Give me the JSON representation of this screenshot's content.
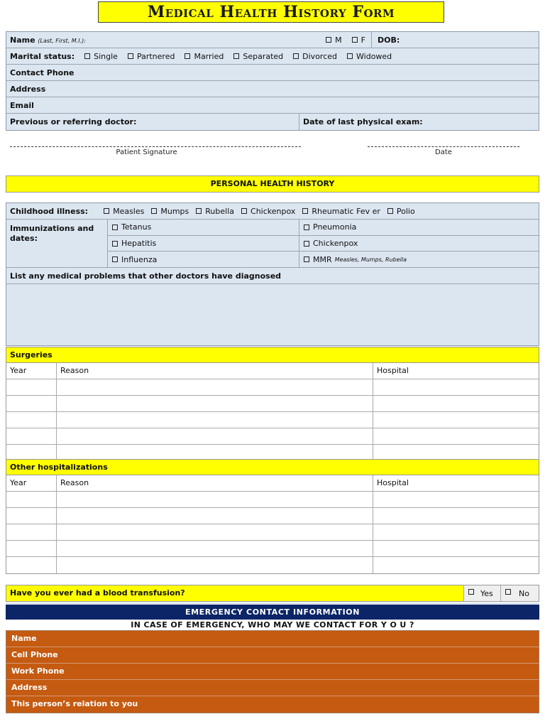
{
  "title": "Medical Health History Form",
  "patient_info": {
    "name_label": "Name",
    "name_hint": "(Last, First, M.I.):",
    "sex_options": [
      "M",
      "F"
    ],
    "dob_label": "DOB:",
    "marital_label": "Marital status:",
    "marital_options": [
      "Single",
      "Partnered",
      "Married",
      "Separated",
      "Divorced",
      "Widowed"
    ],
    "contact_phone_label": "Contact Phone",
    "address_label": "Address",
    "email_label": "Email",
    "doctor_label": "Previous or referring doctor:",
    "last_exam_label": "Date of last physical exam:"
  },
  "signature": {
    "patient_signature_label": "Patient  Signature",
    "date_label": "Date"
  },
  "personal_health": {
    "section_title": "PERSONAL HEALTH  HISTORY",
    "childhood_label": "Childhood illness:",
    "childhood_options": [
      "Measles",
      "Mumps",
      "Rubella",
      "Chickenpox",
      "Rheumatic Fev er",
      "Polio"
    ],
    "immunizations_label": "Immunizations and dates:",
    "immunizations": [
      [
        "Tetanus",
        "Pneumonia"
      ],
      [
        "Hepatitis",
        "Chickenpox"
      ],
      [
        "Influenza",
        "MMR"
      ]
    ],
    "mmr_note": "Measles, Mumps, Rubella",
    "problems_label": "List any medical problems that other doctors have  diagnosed"
  },
  "surgeries": {
    "title": "Surgeries",
    "columns": [
      "Year",
      "Reason",
      "Hospital"
    ],
    "rows": [
      [
        "",
        "",
        ""
      ],
      [
        "",
        "",
        ""
      ],
      [
        "",
        "",
        ""
      ],
      [
        "",
        "",
        ""
      ],
      [
        "",
        "",
        ""
      ]
    ]
  },
  "hospitalizations": {
    "title": "Other hospitalizations",
    "columns": [
      "Year",
      "Reason",
      "Hospital"
    ],
    "rows": [
      [
        "",
        "",
        ""
      ],
      [
        "",
        "",
        ""
      ],
      [
        "",
        "",
        ""
      ],
      [
        "",
        "",
        ""
      ],
      [
        "",
        "",
        ""
      ]
    ]
  },
  "transfusion": {
    "question": "Have you ever had a blood  transfusion?",
    "yes_label": "Yes",
    "no_label": "No"
  },
  "emergency": {
    "title": "EMERGENCY CONTACT INFORMATION",
    "subtitle": "IN CASE OF EMERGENCY, WHO MAY WE CONTACT FOR Y O U ?",
    "fields": [
      "Name",
      "Cell Phone",
      "Work Phone",
      "Address",
      "This person’s relation to you"
    ]
  },
  "colors": {
    "yellow": "#ffff00",
    "light_blue": "#dce6f1",
    "navy": "#0c2566",
    "orange": "#c55a11"
  }
}
